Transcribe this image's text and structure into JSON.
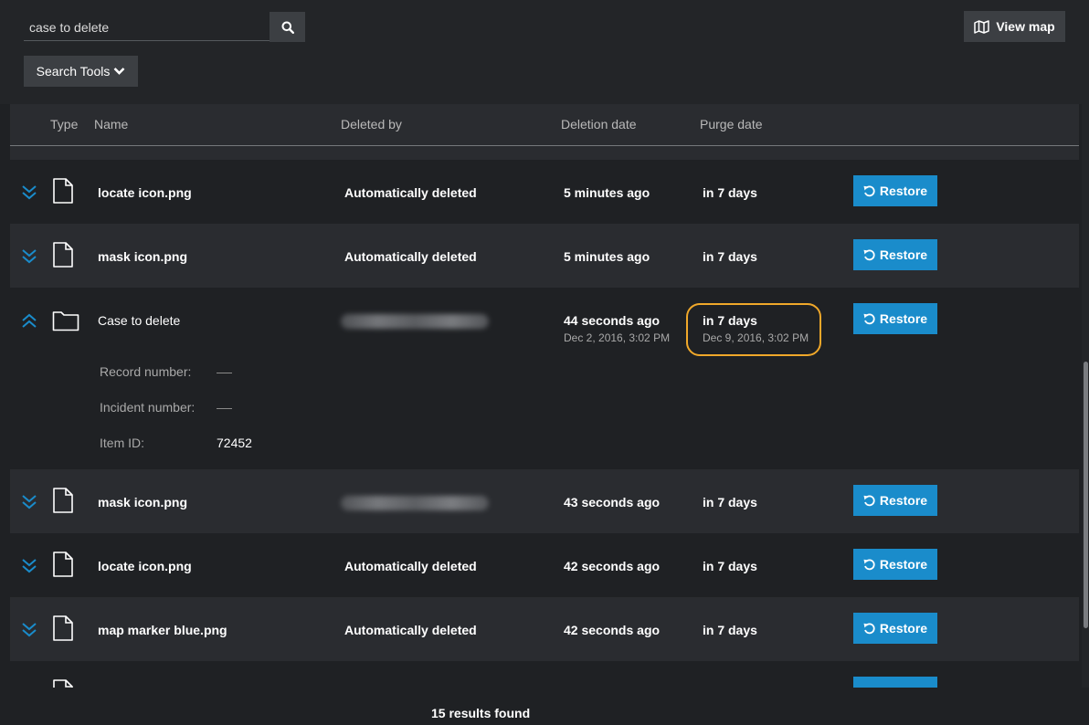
{
  "search": {
    "value": "case to delete",
    "placeholder": ""
  },
  "toolbar": {
    "search_tools_label": "Search Tools",
    "view_map_label": "View map"
  },
  "table": {
    "headers": {
      "type": "Type",
      "name": "Name",
      "deleted_by": "Deleted by",
      "deletion_date": "Deletion date",
      "purge_date": "Purge date"
    },
    "restore_label": "Restore",
    "rows": [
      {
        "name": "locate icon.png",
        "deleted_by": "Automatically deleted",
        "deletion_date": "5 minutes ago",
        "purge_date": "in 7 days"
      },
      {
        "name": "mask icon.png",
        "deleted_by": "Automatically deleted",
        "deletion_date": "5 minutes ago",
        "purge_date": "in 7 days"
      },
      {
        "name": "Case to delete",
        "deleted_by": "",
        "deletion_date": "44 seconds ago",
        "deletion_date_full": "Dec 2, 2016, 3:02 PM",
        "purge_date": "in 7 days",
        "purge_date_full": "Dec 9, 2016, 3:02 PM",
        "details": {
          "record_label": "Record number:",
          "incident_label": "Incident number:",
          "item_id_label": "Item ID:",
          "item_id": "72452"
        }
      },
      {
        "name": "mask icon.png",
        "deleted_by": "",
        "deletion_date": "43 seconds ago",
        "purge_date": "in 7 days"
      },
      {
        "name": "locate icon.png",
        "deleted_by": "Automatically deleted",
        "deletion_date": "42 seconds ago",
        "purge_date": "in 7 days"
      },
      {
        "name": "map marker blue.png",
        "deleted_by": "Automatically deleted",
        "deletion_date": "42 seconds ago",
        "purge_date": "in 7 days"
      }
    ]
  },
  "footer": {
    "results": "15 results found"
  },
  "colors": {
    "accent": "#1a8ccb",
    "highlight": "#f0a82a",
    "background": "#1f2124"
  }
}
